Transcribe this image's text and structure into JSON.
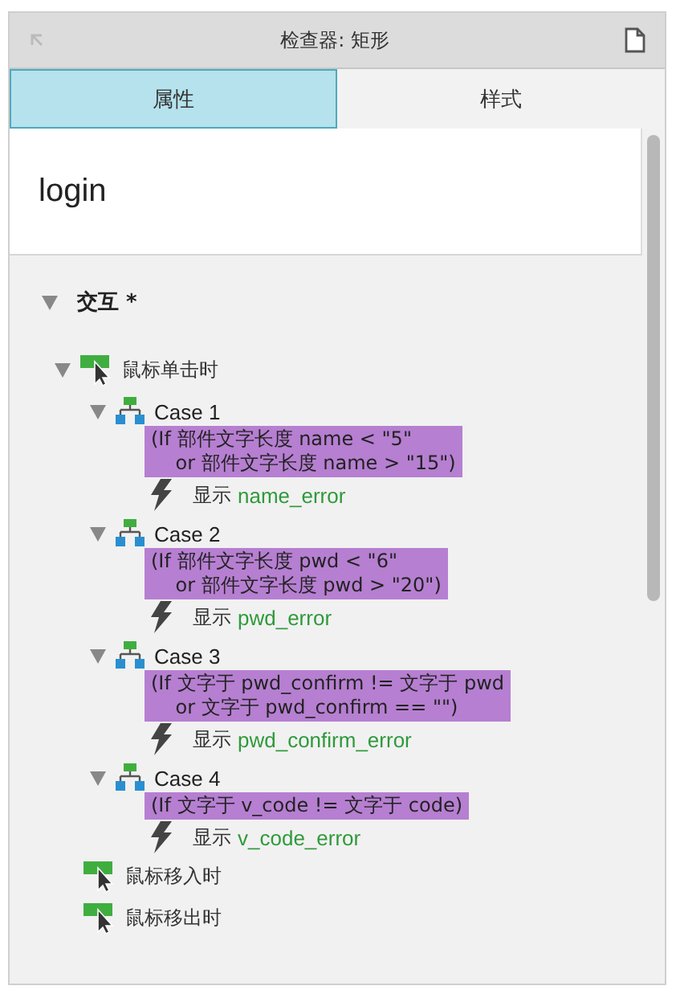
{
  "window": {
    "title": "检查器: 矩形"
  },
  "tabs": [
    {
      "label": "属性",
      "selected": true
    },
    {
      "label": "样式",
      "selected": false
    }
  ],
  "widget_name": "login",
  "section": {
    "title": "交互 *",
    "expanded": true
  },
  "events": [
    {
      "label": "鼠标单击时",
      "expanded": true,
      "cases": [
        {
          "title": "Case 1",
          "expanded": true,
          "condition": "(If 部件文字长度 name < \"5\"\n    or 部件文字长度 name > \"15\")",
          "action": "显示",
          "target": "name_error"
        },
        {
          "title": "Case 2",
          "expanded": true,
          "condition": "(If 部件文字长度 pwd < \"6\"\n    or 部件文字长度 pwd > \"20\")",
          "action": "显示",
          "target": "pwd_error"
        },
        {
          "title": "Case 3",
          "expanded": true,
          "condition": "(If 文字于 pwd_confirm != 文字于 pwd\n    or 文字于 pwd_confirm == \"\")",
          "action": "显示",
          "target": "pwd_confirm_error"
        },
        {
          "title": "Case 4",
          "expanded": true,
          "condition": "(If 文字于 v_code != 文字于 code)",
          "action": "显示",
          "target": "v_code_error"
        }
      ]
    },
    {
      "label": "鼠标移入时"
    },
    {
      "label": "鼠标移出时"
    }
  ]
}
